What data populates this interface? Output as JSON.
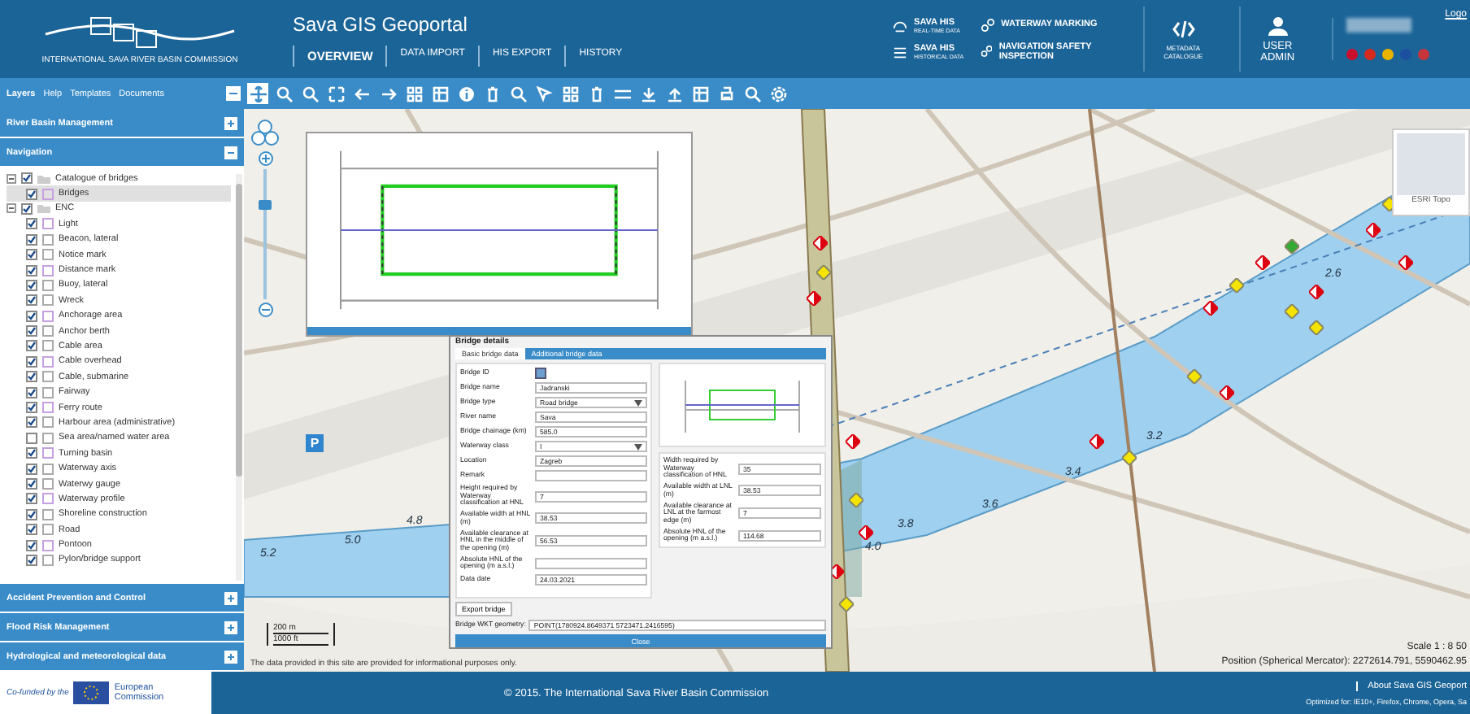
{
  "header": {
    "logo_caption": "INTERNATIONAL SAVA RIVER BASIN COMMISSION",
    "title": "Sava GIS Geoportal",
    "nav": [
      {
        "label": "OVERVIEW",
        "selected": true
      },
      {
        "label": "DATA IMPORT",
        "selected": false
      },
      {
        "label": "HIS EXPORT",
        "selected": false
      },
      {
        "label": "HISTORY",
        "selected": false
      }
    ],
    "his_links": [
      {
        "kind": "realtime",
        "title": "SAVA HIS",
        "subtitle": "REAL-TIME DATA"
      },
      {
        "kind": "historical",
        "title": "SAVA HIS",
        "subtitle": "HISTORICAL DATA"
      }
    ],
    "marking_links": [
      "WATERWAY MARKING",
      "NAVIGATION SAFETY INSPECTION"
    ],
    "metadata": "METADATA CATALOGUE",
    "user_admin": "USER ADMIN",
    "logout": "Logo",
    "flags": [
      {
        "color": "#c8102e"
      },
      {
        "color": "#d52b1e"
      },
      {
        "color": "#e8b400"
      },
      {
        "color": "#1d4fa0"
      },
      {
        "color": "#c6363c"
      }
    ]
  },
  "toolbar": {
    "layers": "Layers",
    "help": "Help",
    "templates": "Templates",
    "documents": "Documents",
    "tools": [
      {
        "kind": "pan",
        "selected": true
      },
      {
        "kind": "zoom",
        "selected": false
      },
      {
        "kind": "search",
        "selected": false
      },
      {
        "kind": "extent",
        "selected": false
      },
      {
        "kind": "back",
        "selected": false
      },
      {
        "kind": "forward",
        "selected": false
      },
      {
        "kind": "grid",
        "selected": false
      },
      {
        "kind": "table",
        "selected": false
      },
      {
        "kind": "info",
        "selected": false
      },
      {
        "kind": "trash",
        "selected": false
      },
      {
        "kind": "search",
        "selected": false
      },
      {
        "kind": "pointer",
        "selected": false
      },
      {
        "kind": "grid",
        "selected": false
      },
      {
        "kind": "trash",
        "selected": false
      },
      {
        "kind": "line",
        "selected": false
      },
      {
        "kind": "download",
        "selected": false
      },
      {
        "kind": "upload",
        "selected": false
      },
      {
        "kind": "table",
        "selected": false
      },
      {
        "kind": "print",
        "selected": false
      },
      {
        "kind": "search",
        "selected": false
      },
      {
        "kind": "settings",
        "selected": false
      }
    ]
  },
  "sidebar": {
    "sections_top": [
      {
        "label": "River Basin Management",
        "expanded": false
      },
      {
        "label": "Navigation",
        "expanded": true
      }
    ],
    "tree": [
      {
        "label": "Catalogue of bridges",
        "checked": true,
        "expanded": true,
        "children": [
          {
            "label": "Bridges",
            "checked": true,
            "selected": true
          }
        ]
      },
      {
        "label": "ENC",
        "checked": true,
        "expanded": true,
        "children": [
          {
            "label": "Light",
            "checked": true,
            "selected": false
          },
          {
            "label": "Beacon, lateral",
            "checked": true,
            "selected": false
          },
          {
            "label": "Notice mark",
            "checked": true,
            "selected": false
          },
          {
            "label": "Distance mark",
            "checked": true,
            "selected": false
          },
          {
            "label": "Buoy, lateral",
            "checked": true,
            "selected": false
          },
          {
            "label": "Wreck",
            "checked": true,
            "selected": false
          },
          {
            "label": "Anchorage area",
            "checked": true,
            "selected": false
          },
          {
            "label": "Anchor berth",
            "checked": true,
            "selected": false
          },
          {
            "label": "Cable area",
            "checked": true,
            "selected": false
          },
          {
            "label": "Cable overhead",
            "checked": true,
            "selected": false
          },
          {
            "label": "Cable, submarine",
            "checked": true,
            "selected": false
          },
          {
            "label": "Fairway",
            "checked": true,
            "selected": false
          },
          {
            "label": "Ferry route",
            "checked": true,
            "selected": false
          },
          {
            "label": "Harbour area (administrative)",
            "checked": true,
            "selected": false
          },
          {
            "label": "Sea area/named water area",
            "checked": false,
            "selected": false
          },
          {
            "label": "Turning basin",
            "checked": true,
            "selected": false
          },
          {
            "label": "Waterway axis",
            "checked": true,
            "selected": false
          },
          {
            "label": "Waterwy gauge",
            "checked": true,
            "selected": false
          },
          {
            "label": "Waterway profile",
            "checked": true,
            "selected": false
          },
          {
            "label": "Shoreline construction",
            "checked": true,
            "selected": false
          },
          {
            "label": "Road",
            "checked": true,
            "selected": false
          },
          {
            "label": "Pontoon",
            "checked": true,
            "selected": false
          },
          {
            "label": "Pylon/bridge support",
            "checked": true,
            "selected": false
          }
        ]
      }
    ],
    "sections_bottom": [
      {
        "label": "Accident Prevention and Control",
        "expanded": false
      },
      {
        "label": "Flood Risk Management",
        "expanded": false
      },
      {
        "label": "Hydrological and meteorological data",
        "expanded": false
      }
    ]
  },
  "map": {
    "km_labels": [
      "5.2",
      "5.0",
      "4.8",
      "4.0",
      "3.8",
      "3.6",
      "3.4",
      "3.2",
      "2.6"
    ],
    "zoom": {
      "level": 0.75
    },
    "basemap": "ESRI Topo",
    "sign": "P",
    "scale_bar": [
      "200 m",
      "1000 ft"
    ],
    "disclaimer": "The data provided in this site are provided for informational purposes only.",
    "scale": "Scale 1 : 8 50",
    "position": "Position (Spherical Mercator): 2272614.791, 5590462.95"
  },
  "dialog": {
    "title": "Bridge details",
    "tabs": [
      {
        "label": "Basic bridge data",
        "selected": true
      },
      {
        "label": "Additional bridge data",
        "selected": false
      }
    ],
    "left_fields": [
      {
        "label": "Bridge ID",
        "kind": "check",
        "checked": true
      },
      {
        "label": "Bridge name",
        "kind": "text",
        "value": "Jadranski"
      },
      {
        "label": "Bridge type",
        "kind": "select",
        "value": "Road bridge"
      },
      {
        "label": "River name",
        "kind": "text",
        "value": "Sava"
      },
      {
        "label": "Bridge chainage (km)",
        "kind": "text",
        "value": "585.0"
      },
      {
        "label": "Waterway class",
        "kind": "select",
        "value": "I"
      },
      {
        "label": "Location",
        "kind": "text",
        "value": "Zagreb"
      },
      {
        "label": "Remark",
        "kind": "text"
      },
      {
        "label": "Height required by Waterway classification at HNL",
        "kind": "text",
        "value": "7"
      },
      {
        "label": "Available width at HNL (m)",
        "kind": "text",
        "value": "38.53"
      },
      {
        "label": "Available clearance at HNL in the middle of the opening (m)",
        "kind": "text",
        "value": "56.53"
      },
      {
        "label": "Absolute HNL of the opening (m a.s.l.)",
        "kind": "text"
      },
      {
        "label": "Data date",
        "kind": "text",
        "value": "24.03.2021"
      }
    ],
    "right_fields": [
      {
        "label": "Width required by Waterway classification of HNL",
        "value": "35"
      },
      {
        "label": "Available width at LNL (m)",
        "value": "38.53"
      },
      {
        "label": "Available clearance at LNL at the farmost edge (m)",
        "value": "7"
      },
      {
        "label": "Absolute HNL of the opening (m a.s.l.)",
        "value": "114.68"
      }
    ],
    "export": "Export bridge",
    "wkt_label": "Bridge WKT geometry:",
    "wkt": "POINT(1780924.8649371 5723471.2416595)",
    "close": "Close"
  },
  "footer": {
    "cofunded": "Co-funded by the",
    "eu": "European Commission",
    "copyright": "© 2015. The International Sava River Basin Commission",
    "about": "About Sava GIS Geoport",
    "optimized": "Optimized for: IE10+, Firefox, Chrome, Opera, Sa"
  }
}
